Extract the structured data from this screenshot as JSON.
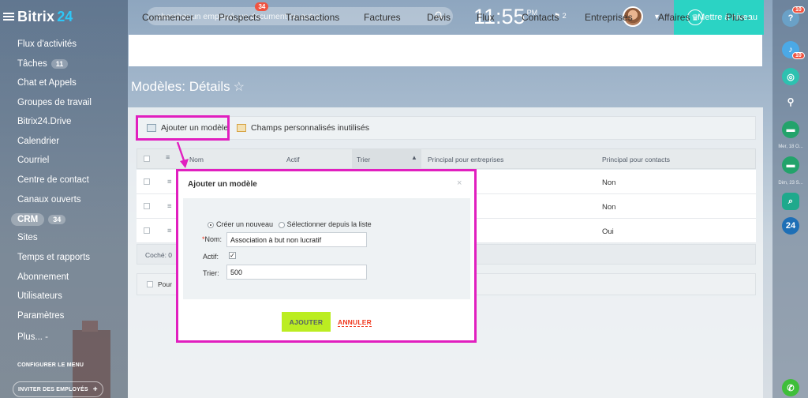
{
  "app": {
    "name": "Bitrix",
    "name_suffix": "24"
  },
  "sidebar": {
    "items": [
      {
        "label": "Flux d'activités"
      },
      {
        "label": "Tâches",
        "count": "11"
      },
      {
        "label": "Chat et Appels"
      },
      {
        "label": "Groupes de travail"
      },
      {
        "label": "Bitrix24.Drive"
      },
      {
        "label": "Calendrier"
      },
      {
        "label": "Courriel"
      },
      {
        "label": "Centre de contact"
      },
      {
        "label": "Canaux ouverts"
      },
      {
        "label": "CRM",
        "count": "34",
        "active": true
      },
      {
        "label": "Sites"
      },
      {
        "label": "Temps et rapports"
      },
      {
        "label": "Abonnement"
      },
      {
        "label": "Utilisateurs"
      },
      {
        "label": "Paramètres"
      },
      {
        "label": "Plus... -"
      }
    ],
    "configure_label": "CONFIGURER LE MENU",
    "invite_label": "INVITER DES EMPLOYÉS",
    "invite_plus": "+"
  },
  "header": {
    "search_placeholder": "chercher un employé, un document ou autre...",
    "time": "11:55",
    "ampm": "PM",
    "flag_count": "2",
    "upgrade_label": "Mettre à niveau"
  },
  "tabs": [
    {
      "label": "Commencer"
    },
    {
      "label": "Prospects",
      "badge": "34"
    },
    {
      "label": "Transactions"
    },
    {
      "label": "Factures"
    },
    {
      "label": "Devis"
    },
    {
      "label": "Flux"
    },
    {
      "label": "Contacts"
    },
    {
      "label": "Entreprises"
    },
    {
      "label": "Affaires"
    },
    {
      "label": "Plus -"
    }
  ],
  "page": {
    "title": "Modèles: Détails",
    "star": "☆"
  },
  "toolbar": {
    "add_model_label": "Ajouter un modèle",
    "custom_fields_label": "Champs personnalisés inutilisés"
  },
  "grid": {
    "columns": [
      "Nom",
      "Actif",
      "Trier",
      "Principal pour entreprises",
      "Principal pour contacts"
    ],
    "rows": [
      {
        "contacts_default": "Non"
      },
      {
        "contacts_default": "Non"
      },
      {
        "contacts_default": "Oui"
      }
    ],
    "footer_checked": "Coché: 0",
    "panel_label": "Pour"
  },
  "rightbar": {
    "help_badge": "10",
    "bell_badge": "10",
    "labels": [
      "Mer, 18 O...",
      "Dim, 23 S..."
    ],
    "b24_label": "24"
  },
  "modal": {
    "title": "Ajouter un modèle",
    "close": "×",
    "radio_new": "Créer un nouveau",
    "radio_select": "Sélectionner depuis la liste",
    "name_required": "*",
    "name_label": "Nom:",
    "name_value": "Association à but non lucratif",
    "active_label": "Actif:",
    "active_checked": true,
    "sort_label": "Trier:",
    "sort_value": "500",
    "ok_label": "AJOUTER",
    "cancel_label": "ANNULER"
  },
  "colors": {
    "accent_upgrade": "#2bd3c4",
    "highlight": "#e11fbf",
    "ok_button": "#bbed21",
    "cancel_text": "#f0371d",
    "badge": "#f05340"
  }
}
